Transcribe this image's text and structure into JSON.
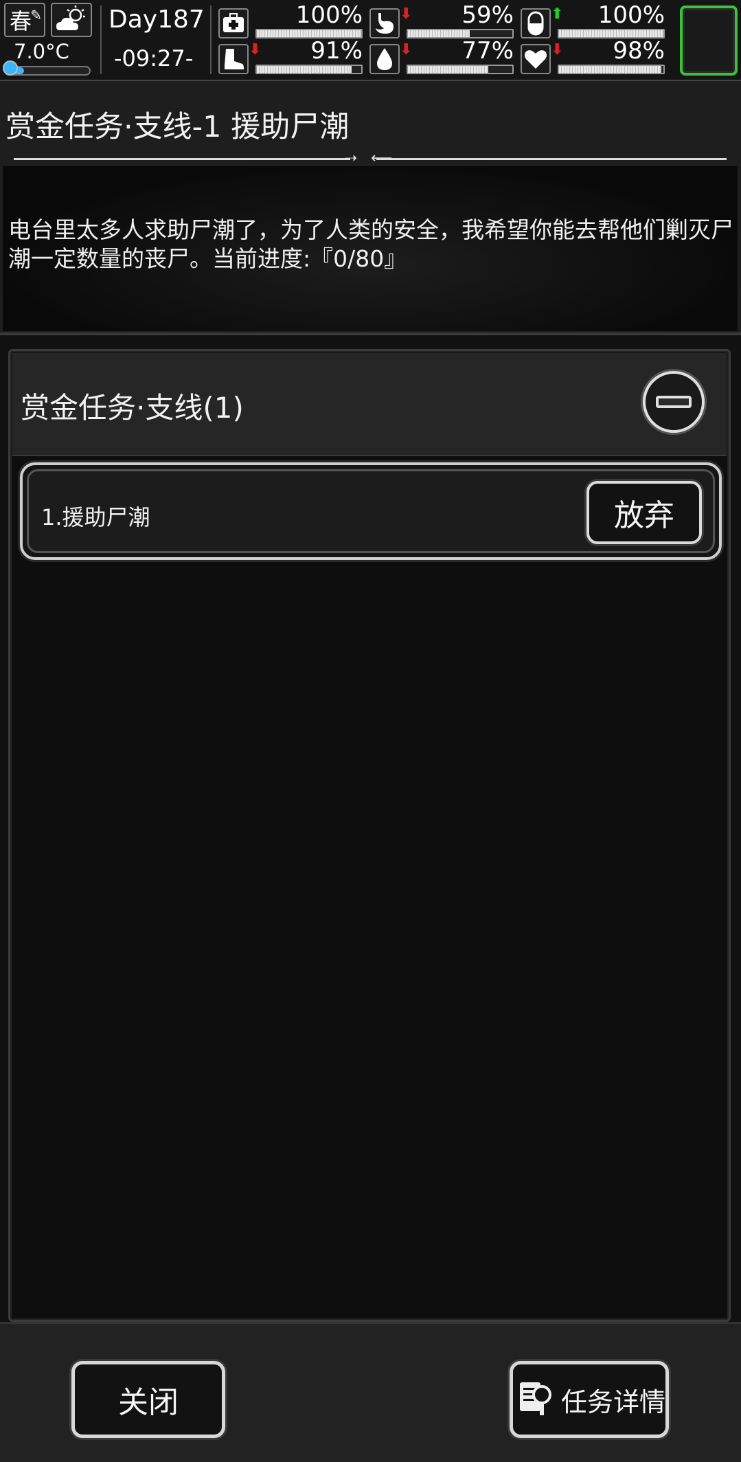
{
  "hud": {
    "season": "春",
    "temperature": "7.0°C",
    "temperature_level": 0.22,
    "day": "Day187",
    "time": "-09:27-",
    "stats": [
      {
        "name": "health",
        "icon": "first-aid-kit-icon",
        "value": "100%",
        "level": 1.0,
        "trend": "none"
      },
      {
        "name": "hunger",
        "icon": "stomach-icon",
        "value": "59%",
        "level": 0.59,
        "trend": "down"
      },
      {
        "name": "medicine",
        "icon": "pill-icon",
        "value": "100%",
        "level": 1.0,
        "trend": "up"
      },
      {
        "name": "stamina",
        "icon": "boot-icon",
        "value": "91%",
        "level": 0.91,
        "trend": "down"
      },
      {
        "name": "thirst",
        "icon": "water-drop-icon",
        "value": "77%",
        "level": 0.77,
        "trend": "down"
      },
      {
        "name": "mood",
        "icon": "heart-icon",
        "value": "98%",
        "level": 0.98,
        "trend": "down"
      }
    ]
  },
  "quest": {
    "title": "赏金任务·支线-1 援助尸潮",
    "description": "电台里太多人求助尸潮了，为了人类的安全，我希望你能去帮他们剿灭尸潮一定数量的丧尸。当前进度:『0/80』"
  },
  "list": {
    "category": "赏金任务·支线(1)",
    "items": [
      {
        "name": "1.援助尸潮",
        "action": "放弃"
      }
    ]
  },
  "buttons": {
    "close": "关闭",
    "details": "任务详情"
  }
}
